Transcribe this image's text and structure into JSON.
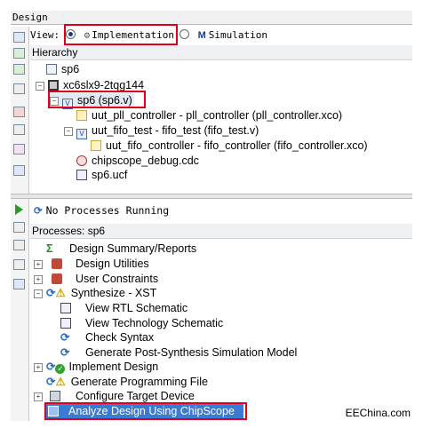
{
  "window": {
    "title": "Design"
  },
  "view": {
    "label": "View:",
    "implementation_label": "Implementation",
    "simulation_label": "Simulation",
    "selected": "Implementation"
  },
  "hierarchy": {
    "title": "Hierarchy",
    "items": [
      {
        "label": "sp6",
        "icon": "project-icon"
      },
      {
        "label": "xc6slx9-2tqg144",
        "icon": "chip-icon"
      },
      {
        "label": "sp6 (sp6.v)",
        "icon": "verilog-module-icon"
      },
      {
        "label": "uut_pll_controller - pll_controller (pll_controller.xco)",
        "icon": "ip-core-icon"
      },
      {
        "label": "uut_fifo_test - fifo_test (fifo_test.v)",
        "icon": "verilog-file-icon"
      },
      {
        "label": "uut_fifo_controller - fifo_controller (fifo_controller.xco)",
        "icon": "ip-core-icon"
      },
      {
        "label": "chipscope_debug.cdc",
        "icon": "chipscope-icon"
      },
      {
        "label": "sp6.ucf",
        "icon": "constraints-icon"
      }
    ]
  },
  "status": {
    "text": "No Processes Running"
  },
  "processes": {
    "title": "Processes: sp6",
    "items": [
      {
        "label": "Design Summary/Reports"
      },
      {
        "label": "Design Utilities"
      },
      {
        "label": "User Constraints"
      },
      {
        "label": "Synthesize - XST"
      },
      {
        "label": "View RTL Schematic"
      },
      {
        "label": "View Technology Schematic"
      },
      {
        "label": "Check Syntax"
      },
      {
        "label": "Generate Post-Synthesis Simulation Model"
      },
      {
        "label": "Implement Design"
      },
      {
        "label": "Generate Programming File"
      },
      {
        "label": "Configure Target Device"
      },
      {
        "label": "Analyze Design Using ChipScope"
      }
    ]
  },
  "watermark": {
    "text": "EEChina.com"
  },
  "colors": {
    "highlight": "#3a7bd5",
    "annotation": "#e0001a"
  }
}
